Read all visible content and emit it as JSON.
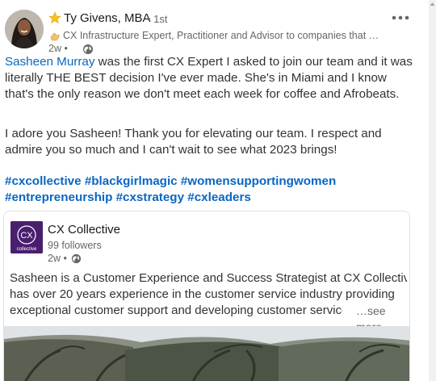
{
  "author": {
    "name": "Ty Givens, MBA",
    "degree": "• 1st",
    "headline": "CX Infrastructure Expert, Practitioner and Advisor to companies that wan…",
    "timestamp": "2w •"
  },
  "post": {
    "mention": "Sasheen Murray",
    "paragraph1_rest": " was the first CX Expert I asked to join our team and it was literally THE BEST decision I've ever made. She's in Miami and I know that's the only reason we don't meet each week for coffee and Afrobeats.",
    "paragraph2": "I adore you Sasheen! Thank you for elevating our team. I respect and admire you so much and I can't wait to see what 2023 brings!",
    "hashtags": [
      "#cxcollective",
      "#blackgirlmagic",
      "#womensupportingwomen",
      "#entrepreneurship",
      "#cxstrategy",
      "#cxleaders"
    ]
  },
  "shared_post": {
    "org_name": "CX Collective",
    "logo_text": "CX",
    "logo_subtext": "collective",
    "followers": "99 followers",
    "timestamp": "2w •",
    "line1": "Sasheen is a Customer Experience and Success Strategist at CX Collective. She",
    "line2": "has over 20 years experience in the customer service industry providing",
    "line3": "exceptional customer support and developing customer service sys",
    "see_more": "…see more"
  },
  "icons": {
    "star": "star-icon",
    "headline_badge": "hand-icon",
    "globe": "globe-icon",
    "more": "more-options-icon"
  },
  "colors": {
    "link": "#0a66c2",
    "muted": "#666666",
    "star": "#f5c024",
    "logo_bg": "#4a1e6e"
  }
}
